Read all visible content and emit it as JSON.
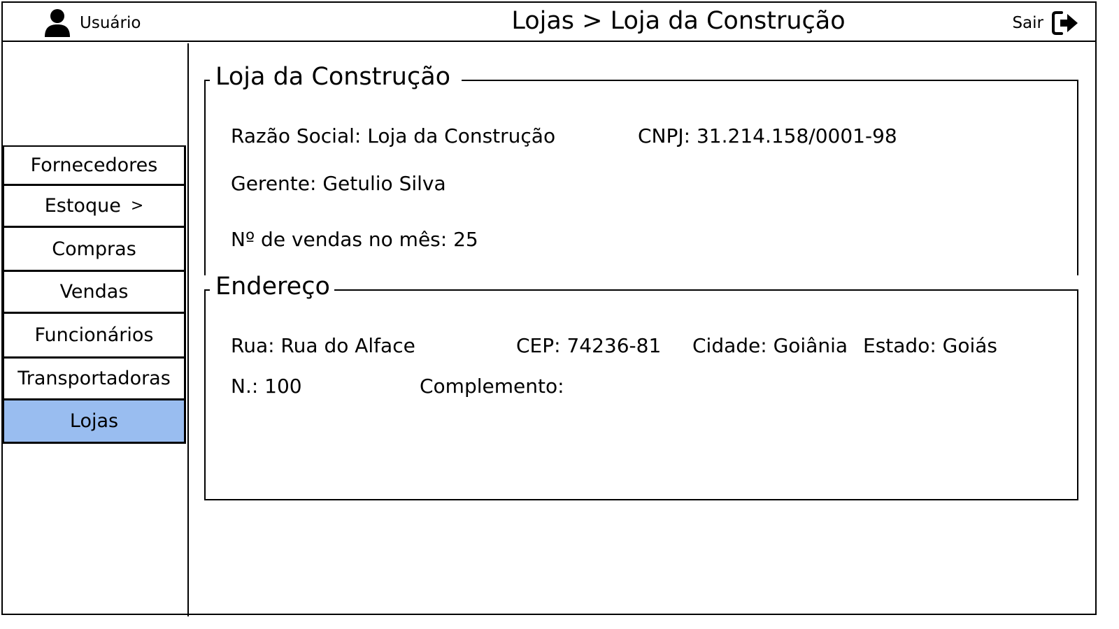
{
  "header": {
    "user_label": "Usuário",
    "user_icon": "user-icon",
    "breadcrumb": "Lojas > Loja da Construção",
    "exit_label": "Sair",
    "exit_icon": "sign-out-icon"
  },
  "sidebar": {
    "items": [
      {
        "label": "Fornecedores"
      },
      {
        "label": "Estoque",
        "chevron": ">"
      },
      {
        "label": "Compras"
      },
      {
        "label": "Vendas"
      },
      {
        "label": "Funcionários"
      },
      {
        "label": "Transportadoras"
      },
      {
        "label": "Lojas",
        "active": true
      }
    ],
    "active_color": "#99bdf0"
  },
  "store": {
    "title": "Loja da Construção",
    "razao_social": "Razão Social: Loja da Construção",
    "cnpj": "CNPJ: 31.214.158/0001-98",
    "gerente": "Gerente: Getulio Silva",
    "vendas": "Nº de vendas no mês: 25"
  },
  "address": {
    "title": "Endereço",
    "rua": "Rua: Rua do Alface",
    "cep": "CEP: 74236-81",
    "cidade": "Cidade: Goiânia",
    "estado": "Estado: Goiás",
    "numero": "N.: 100",
    "complemento": "Complemento:"
  }
}
